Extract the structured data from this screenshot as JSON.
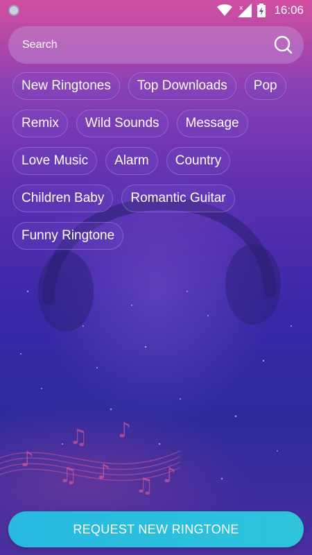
{
  "status_bar": {
    "time": "16:06",
    "icons": [
      "notification-dot-icon",
      "wifi-icon",
      "signal-icon",
      "battery-charging-icon"
    ]
  },
  "search": {
    "placeholder": "Search",
    "icon": "search-icon"
  },
  "tags": [
    {
      "label": "New Ringtones"
    },
    {
      "label": "Top Downloads"
    },
    {
      "label": "Pop"
    },
    {
      "label": "Remix"
    },
    {
      "label": "Wild Sounds"
    },
    {
      "label": "Message"
    },
    {
      "label": "Love Music"
    },
    {
      "label": "Alarm"
    },
    {
      "label": "Country"
    },
    {
      "label": "Children Baby"
    },
    {
      "label": "Romantic Guitar"
    },
    {
      "label": "Funny Ringtone"
    }
  ],
  "request_button": {
    "label": "REQUEST NEW RINGTONE"
  },
  "colors": {
    "accent": "#2ec4dc",
    "background_top": "#d24fa0",
    "background_bottom": "#2d2a9e"
  }
}
